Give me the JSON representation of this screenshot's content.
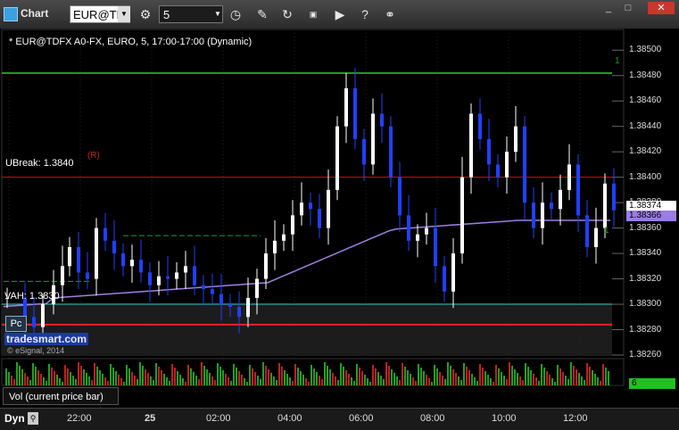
{
  "app": {
    "title": "Chart"
  },
  "toolbar": {
    "symbol": "EUR@TD",
    "interval": "5"
  },
  "chart_header": "* EUR@TDFX A0-FX, EURO, 5, 17:00-17:00 (Dynamic)",
  "price_axis": [
    "1.38500",
    "1.38480",
    "1.38460",
    "1.38440",
    "1.38420",
    "1.38400",
    "1.38380",
    "1.38360",
    "1.38340",
    "1.38320",
    "1.38300",
    "1.38280",
    "1.38260"
  ],
  "current_price": "1.38374",
  "ma_price": "1.38366",
  "levels": {
    "ubreak_label": "UBreak: 1.3840",
    "r_label": "(R)",
    "vah_label": "VAH: 1.3830",
    "pc_label": "Pc",
    "green_top_label": "1",
    "green_small_label": "1"
  },
  "watermark": {
    "brand": "tradesmart.com",
    "copyright": "© eSignal, 2014"
  },
  "volume": {
    "label": "Vol (current price bar)",
    "value": "6"
  },
  "time_axis": [
    "22:00",
    "25",
    "02:00",
    "04:00",
    "06:00",
    "08:00",
    "10:00",
    "12:00"
  ],
  "bottom": {
    "dyn_label": "Dyn"
  },
  "colors": {
    "ubreak": "#d01010",
    "vah": "#30c0c0",
    "green_level": "#20a020",
    "ma": "#a080e0",
    "bar_up": "#ffffff",
    "bar_down": "#2040ff",
    "ma_badge": "#9a7ee0",
    "vol_badge": "#20c020"
  },
  "chart_data": {
    "type": "candlestick",
    "title": "EUR@TDFX A0-FX, EURO, 5",
    "ylim": [
      1.3826,
      1.3851
    ],
    "y_ticks": [
      1.385,
      1.3848,
      1.3846,
      1.3844,
      1.3842,
      1.384,
      1.3838,
      1.3836,
      1.3834,
      1.3832,
      1.383,
      1.3828,
      1.3826
    ],
    "x_labels": [
      "22:00",
      "25",
      "02:00",
      "04:00",
      "06:00",
      "08:00",
      "10:00",
      "12:00"
    ],
    "reference_lines": [
      {
        "name": "UBreak",
        "value": 1.384
      },
      {
        "name": "VAH",
        "value": 1.383
      },
      {
        "name": "green-top",
        "value": 1.38482
      },
      {
        "name": "red-bottom",
        "value": 1.38284
      }
    ],
    "last_price": 1.38374,
    "moving_average_last": 1.38366
  },
  "icons": [
    "settings-icon",
    "clock-icon",
    "pencil-icon",
    "cycle-icon",
    "gif-icon",
    "play-icon",
    "help-icon",
    "link-icon"
  ]
}
